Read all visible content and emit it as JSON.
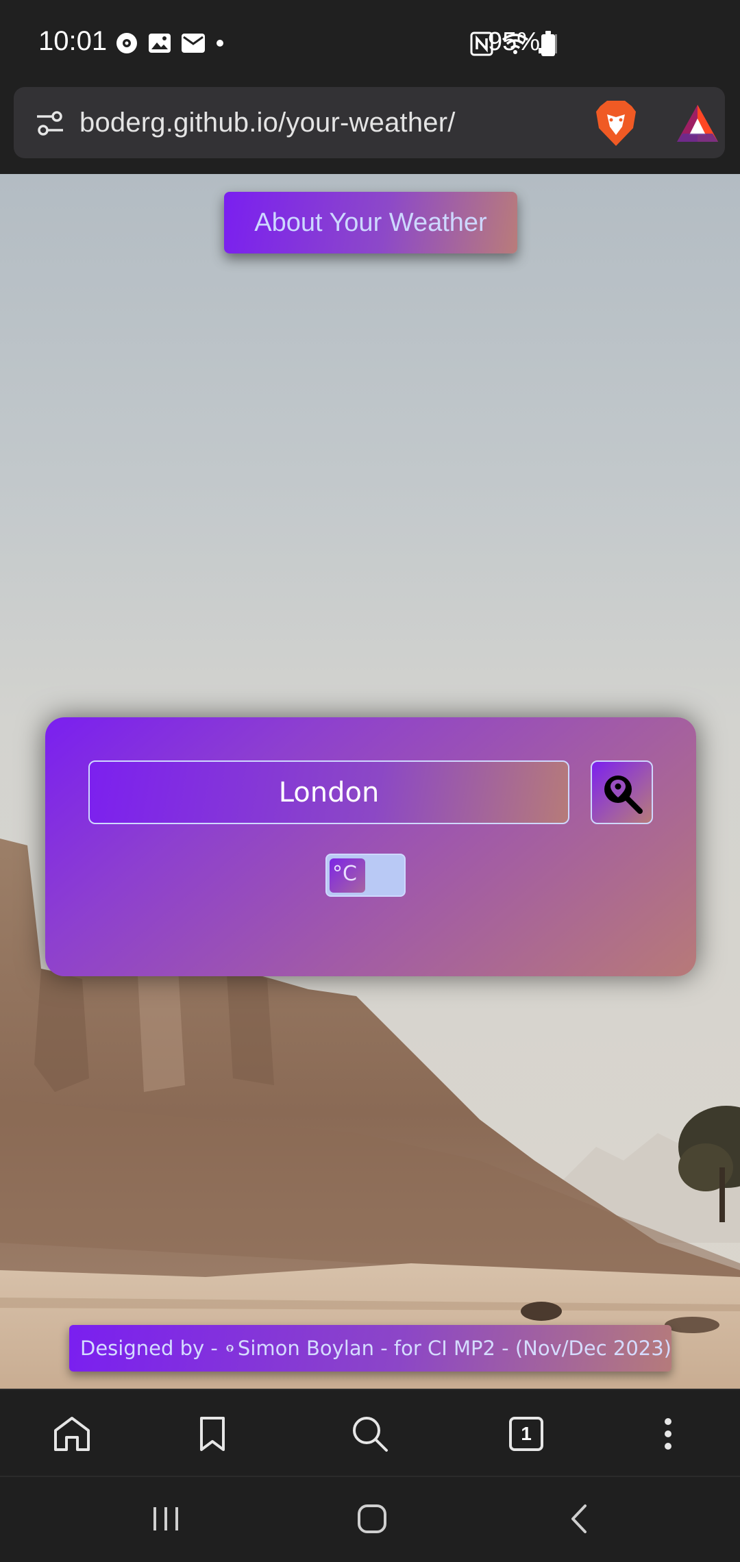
{
  "status_bar": {
    "time": "10:01",
    "battery": "95%"
  },
  "browser": {
    "url": "boderg.github.io/your-weather/"
  },
  "page": {
    "about_button": "About Your Weather",
    "search": {
      "city_value": "London"
    },
    "unit_toggle": {
      "label": "°C"
    },
    "footer": {
      "text_prefix": "Designed by - ",
      "author": "Simon Boylan - for CI MP2 - (Nov/Dec 2023)"
    }
  },
  "toolbar": {
    "tabs_count": "1"
  },
  "colors": {
    "accent_purple": "#7a1ff0",
    "accent_rose": "#b77a78",
    "light_blue": "#cdd8ff"
  }
}
